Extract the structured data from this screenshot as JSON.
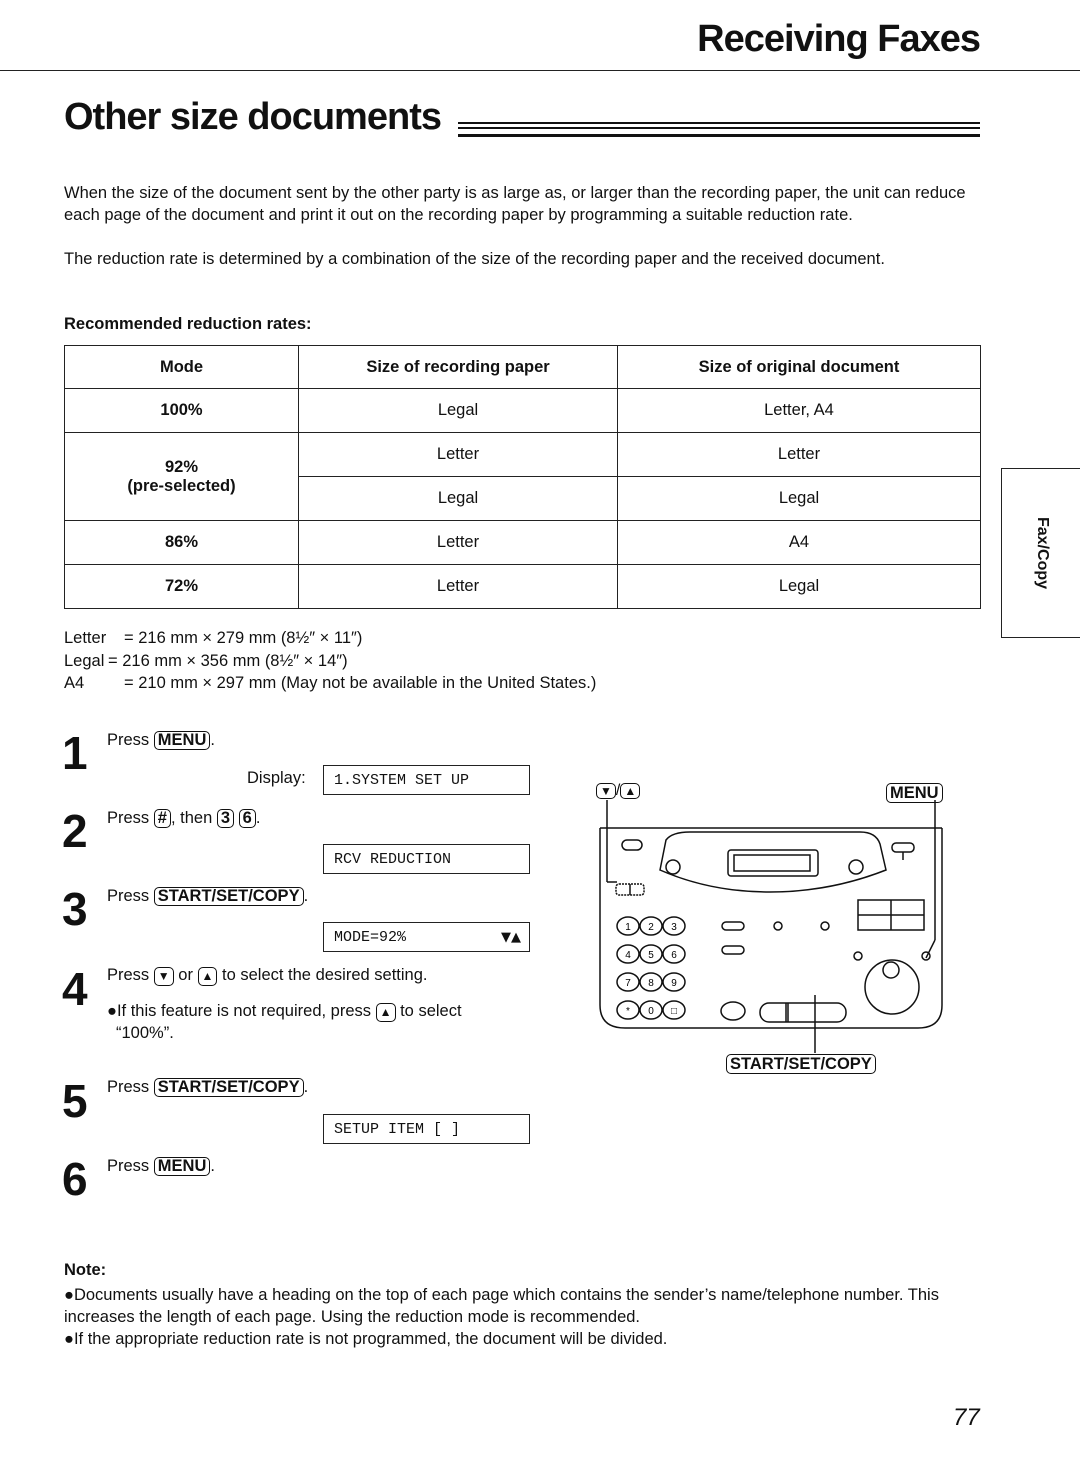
{
  "header": {
    "section_title": "Receiving Faxes",
    "page_title": "Other size documents"
  },
  "intro": {
    "paragraph_1": "When the size of the document sent by the other party is as large as, or larger than the recording paper, the unit can reduce each page of the document and print it out on the recording paper by programming a suitable reduction rate.",
    "paragraph_2": "The reduction rate is determined by a combination of the size of the recording paper and the received document."
  },
  "rates_table": {
    "caption": "Recommended reduction rates:",
    "headers": [
      "Mode",
      "Size of recording paper",
      "Size of original document"
    ],
    "rows": [
      {
        "mode": "100%",
        "paper": "Legal",
        "original": "Letter, A4"
      },
      {
        "mode": "92%",
        "mode_note": "(pre-selected)",
        "paper": "Letter",
        "original": "Letter"
      },
      {
        "mode": "",
        "paper": "Legal",
        "original": "Legal"
      },
      {
        "mode": "86%",
        "paper": "Letter",
        "original": "A4"
      },
      {
        "mode": "72%",
        "paper": "Letter",
        "original": "Legal"
      }
    ]
  },
  "side_tab": {
    "label": "Fax/Copy"
  },
  "size_definitions": [
    {
      "name": "Letter",
      "value": "= 216 mm × 279 mm (8½″ × 11″)"
    },
    {
      "name": "Legal",
      "value": "= 216 mm × 356 mm (8½″ × 14″)"
    },
    {
      "name": "A4",
      "value": "= 210 mm × 297 mm (May not be available in the United States.)"
    }
  ],
  "steps": [
    {
      "num": "1",
      "prefix": "Press",
      "keys": [
        "MENU"
      ],
      "suffix": ".",
      "display_label": "Display:",
      "display": "1.SYSTEM SET UP"
    },
    {
      "num": "2",
      "prefix": "Press",
      "keys": [
        "#",
        "3",
        "6"
      ],
      "joiner": ", then",
      "suffix": ".",
      "display": "RCV REDUCTION"
    },
    {
      "num": "3",
      "prefix": "Press",
      "keys": [
        "START/SET/COPY"
      ],
      "suffix": ".",
      "display": "MODE=92%",
      "display_arrows": "▼▲"
    },
    {
      "num": "4",
      "prefix": "Press",
      "keys": [
        "▼",
        "▲"
      ],
      "joiner": "or",
      "suffix": "to select the desired setting.",
      "bullet_a": "●If this feature is not required, press",
      "bullet_key": "▲",
      "bullet_b": "to select",
      "bullet_c": "“100%”."
    },
    {
      "num": "5",
      "prefix": "Press",
      "keys": [
        "START/SET/COPY"
      ],
      "suffix": ".",
      "display": "SETUP ITEM [   ]"
    },
    {
      "num": "6",
      "prefix": "Press",
      "keys": [
        "MENU"
      ],
      "suffix": "."
    }
  ],
  "diagram": {
    "label_arrows": "▼",
    "label_arrows_sep": "/",
    "label_arrows_up": "▲",
    "label_menu": "MENU",
    "label_start": "START/SET/COPY",
    "keypad": [
      "1",
      "2",
      "3",
      "4",
      "5",
      "6",
      "7",
      "8",
      "9",
      "*",
      "0",
      "□"
    ]
  },
  "notes": {
    "title": "Note:",
    "items": [
      "●Documents usually have a heading on the top of each page which contains the sender’s name/telephone number. This increases the length of each page. Using the reduction mode is recommended.",
      "●If the appropriate reduction rate is not programmed, the document will be divided."
    ]
  },
  "page_number": "77"
}
